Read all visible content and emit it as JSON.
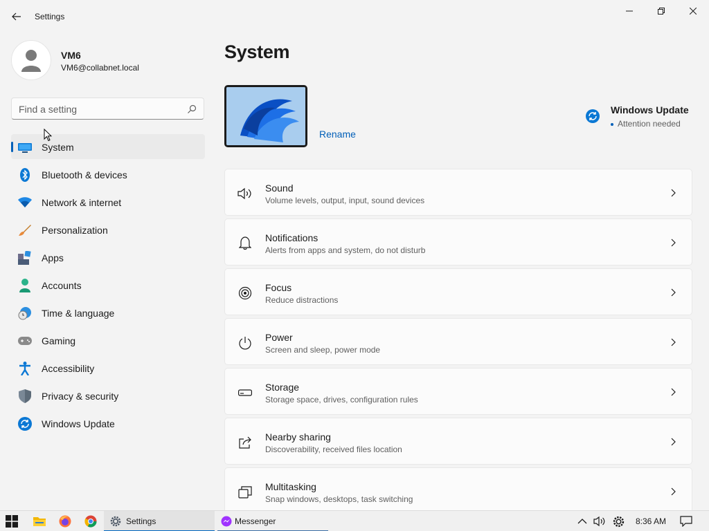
{
  "window": {
    "app_title": "Settings"
  },
  "profile": {
    "name": "VM6",
    "email": "VM6@collabnet.local"
  },
  "search": {
    "placeholder": "Find a setting"
  },
  "sidebar": {
    "items": [
      {
        "label": "System",
        "icon": "system-icon",
        "active": true
      },
      {
        "label": "Bluetooth & devices",
        "icon": "bluetooth-icon"
      },
      {
        "label": "Network & internet",
        "icon": "network-icon"
      },
      {
        "label": "Personalization",
        "icon": "brush-icon"
      },
      {
        "label": "Apps",
        "icon": "apps-icon"
      },
      {
        "label": "Accounts",
        "icon": "accounts-icon"
      },
      {
        "label": "Time & language",
        "icon": "time-language-icon"
      },
      {
        "label": "Gaming",
        "icon": "gamepad-icon"
      },
      {
        "label": "Accessibility",
        "icon": "accessibility-icon"
      },
      {
        "label": "Privacy & security",
        "icon": "shield-icon"
      },
      {
        "label": "Windows Update",
        "icon": "windows-update-icon"
      }
    ]
  },
  "main": {
    "title": "System",
    "rename_label": "Rename",
    "windows_update": {
      "title": "Windows Update",
      "status": "Attention needed"
    },
    "cards": [
      {
        "title": "Sound",
        "subtitle": "Volume levels, output, input, sound devices",
        "icon": "speaker-icon"
      },
      {
        "title": "Notifications",
        "subtitle": "Alerts from apps and system, do not disturb",
        "icon": "bell-icon"
      },
      {
        "title": "Focus",
        "subtitle": "Reduce distractions",
        "icon": "focus-icon"
      },
      {
        "title": "Power",
        "subtitle": "Screen and sleep, power mode",
        "icon": "power-icon"
      },
      {
        "title": "Storage",
        "subtitle": "Storage space, drives, configuration rules",
        "icon": "storage-icon"
      },
      {
        "title": "Nearby sharing",
        "subtitle": "Discoverability, received files location",
        "icon": "share-icon"
      },
      {
        "title": "Multitasking",
        "subtitle": "Snap windows, desktops, task switching",
        "icon": "multitasking-icon"
      }
    ]
  },
  "taskbar": {
    "tasks": [
      {
        "label": "Settings",
        "active": true
      },
      {
        "label": "Messenger",
        "active": false
      }
    ],
    "clock": "8:36 AM"
  },
  "colors": {
    "accent": "#005fb8",
    "background": "#f3f3f3",
    "card": "#fbfbfb"
  }
}
